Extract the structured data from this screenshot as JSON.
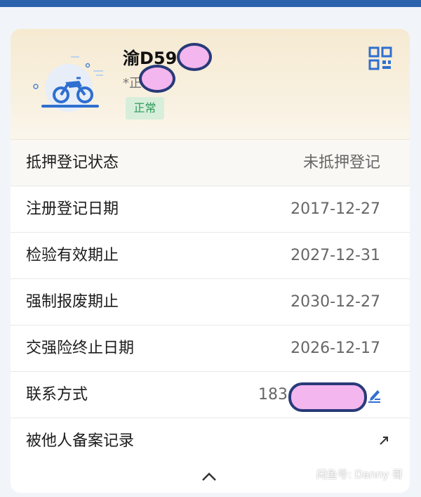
{
  "vehicle": {
    "plate": "渝D59",
    "subline": "*正",
    "status_chip": "正常"
  },
  "icons": {
    "illustration": "motorcycle-icon",
    "qr": "qr-code-icon",
    "edit": "edit-icon",
    "external": "external-link-icon",
    "collapse": "chevron-up-icon"
  },
  "rows": [
    {
      "label": "抵押登记状态",
      "value": "未抵押登记"
    },
    {
      "label": "注册登记日期",
      "value": "2017-12-27"
    },
    {
      "label": "检验有效期止",
      "value": "2027-12-31"
    },
    {
      "label": "强制报废期止",
      "value": "2030-12-27"
    },
    {
      "label": "交强险终止日期",
      "value": "2026-12-17"
    },
    {
      "label": "联系方式",
      "value": "183"
    },
    {
      "label": "被他人备案记录",
      "value": ""
    }
  ],
  "colors": {
    "accent": "#2f6fd0",
    "status_green": "#2d9a58",
    "status_bg": "#d7eedb",
    "redaction": "#f3b6ef"
  },
  "watermark": "闲鱼号: Danny 哥"
}
